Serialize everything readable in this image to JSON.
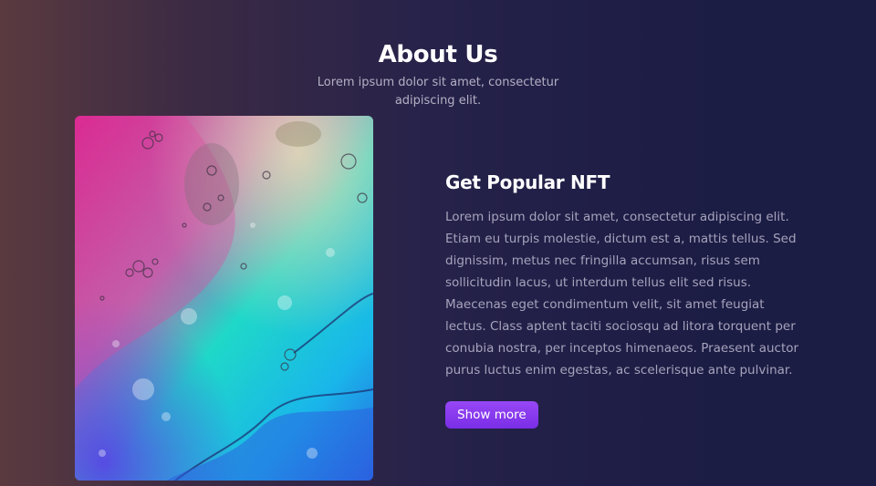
{
  "section": {
    "title": "About Us",
    "subtitle": "Lorem ipsum dolor sit amet, consectetur adipiscing elit."
  },
  "feature": {
    "heading": "Get Popular NFT",
    "paragraph": "Lorem ipsum dolor sit amet, consectetur adipiscing elit. Etiam eu turpis molestie, dictum est a, mattis tellus. Sed dignissim, metus nec fringilla accumsan, risus sem sollicitudin lacus, ut interdum tellus elit sed risus. Maecenas eget condimentum velit, sit amet feugiat lectus. Class aptent taciti sociosqu ad litora torquent per conubia nostra, per inceptos himenaeos. Praesent auctor purus luctus enim egestas, ac scelerisque ante pulvinar.",
    "button_label": "Show more"
  },
  "colors": {
    "accent": "#8a3cf0",
    "background_left": "#5a3a3f",
    "background_right": "#1b1d44"
  }
}
